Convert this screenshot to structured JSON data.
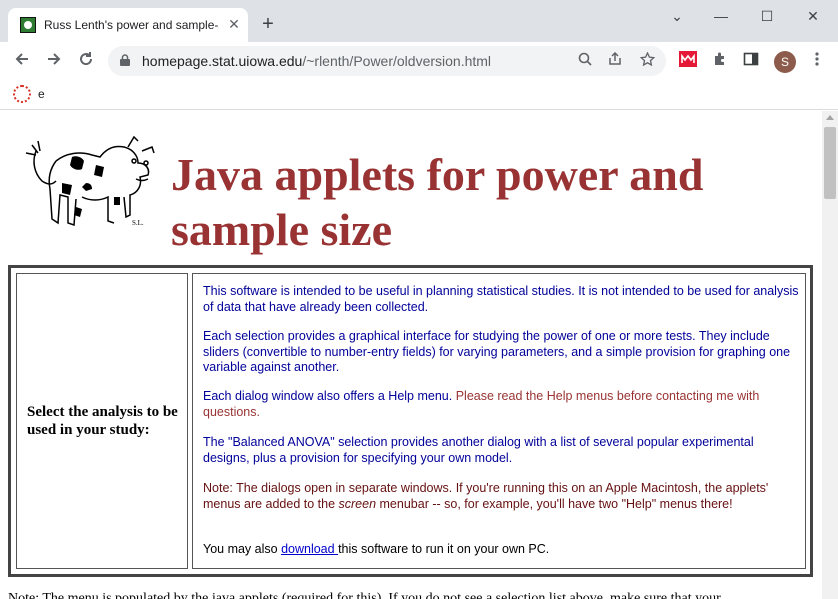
{
  "browser": {
    "tab_title": "Russ Lenth's power and sample-s",
    "tab_close": "✕",
    "new_tab": "+",
    "window_buttons": {
      "chevron": "⌄",
      "minimize": "—",
      "maximize": "☐",
      "close": "✕"
    },
    "url_host": "homepage.stat.uiowa.edu",
    "url_path": "/~rlenth/Power/oldversion.html",
    "profile_initial": "S",
    "bookmark_label": "e"
  },
  "page": {
    "heading": "Java applets for power and sample size",
    "prompt": "Select the analysis to be used in your study:",
    "para1": "This software is intended to be useful in planning statistical studies.  It is not intended to be used for analysis of data that have already been collected.",
    "para2": "Each selection provides a graphical interface for studying the power of one or more tests.  They include sliders (convertible to number-entry fields) for varying parameters, and a simple provision for graphing one variable against another.",
    "para3_a": "Each dialog window also offers a Help menu.  ",
    "para3_b": "Please read the Help menus before contacting me with questions.",
    "para4": "The \"Balanced ANOVA\" selection provides another dialog with a list of several popular experimental designs, plus a provision for specifying your own model.",
    "para5_a": "Note: The dialogs open in separate windows. If you're running this on an Apple Macintosh, the applets' menus are added to the ",
    "para5_b": "screen",
    "para5_c": " menubar -- so, for example, you'll have two \"Help\" menus there!",
    "para6_a": "You may also ",
    "para6_link": "download ",
    "para6_b": "this software to run it on your own PC.",
    "footnote": "Note: The menu is populated by the java applets (required for this). If you do not see a selection list above, make sure that your"
  },
  "colors": {
    "heading": "#993333",
    "body_blue": "#000099",
    "warning_red": "#993333",
    "link": "#0000cc"
  }
}
